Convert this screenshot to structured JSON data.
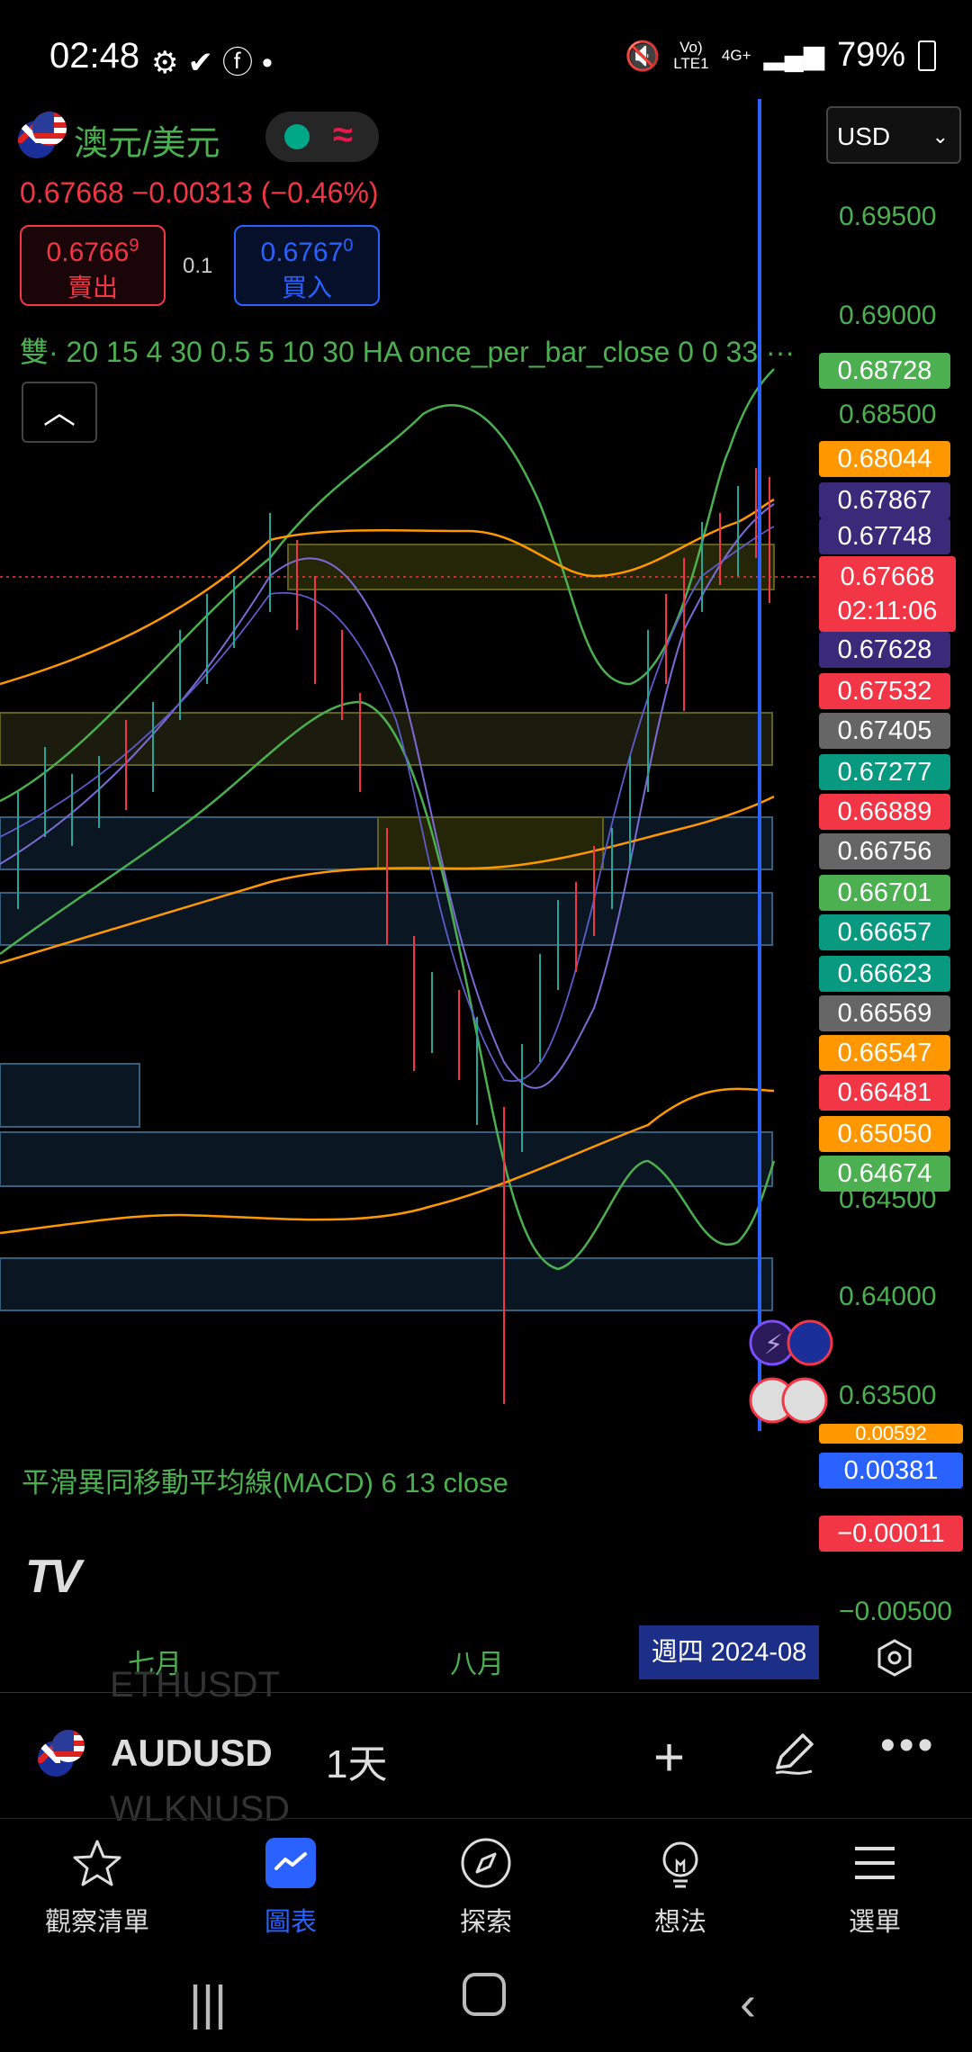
{
  "status_bar": {
    "time": "02:48",
    "network": "Vo) LTE1",
    "network_type": "4G+",
    "battery": "79%"
  },
  "header": {
    "symbol_title": "澳元/美元",
    "price_change": "0.67668 −0.00313 (−0.46%)",
    "sell_price": "0.6766",
    "sell_price_sup": "9",
    "sell_label": "賣出",
    "spread": "0.1",
    "buy_price": "0.6767",
    "buy_price_sup": "0",
    "buy_label": "買入",
    "indicator_settings": "雙· 20 15 4 30 0.5 5 10 30 HA once_per_bar_close 0 0 33 ···",
    "currency": "USD"
  },
  "price_axis": {
    "labels": [
      "0.69500",
      "0.69000",
      "0.68500",
      "0.64500",
      "0.64000",
      "0.63500"
    ]
  },
  "price_tags": [
    {
      "value": "0.68728",
      "color": "#4caf50"
    },
    {
      "value": "0.68044",
      "color": "#ff9800"
    },
    {
      "value": "0.67867",
      "color": "#3a2a7a"
    },
    {
      "value": "0.67748",
      "color": "#3a2a7a"
    },
    {
      "value": "0.67628",
      "color": "#3a2a7a"
    },
    {
      "value": "0.67532",
      "color": "#f23645"
    },
    {
      "value": "0.67405",
      "color": "#666"
    },
    {
      "value": "0.67277",
      "color": "#089981"
    },
    {
      "value": "0.66889",
      "color": "#f23645"
    },
    {
      "value": "0.66756",
      "color": "#666"
    },
    {
      "value": "0.66701",
      "color": "#4caf50"
    },
    {
      "value": "0.66657",
      "color": "#089981"
    },
    {
      "value": "0.66623",
      "color": "#089981"
    },
    {
      "value": "0.66569",
      "color": "#666"
    },
    {
      "value": "0.66547",
      "color": "#ff9800"
    },
    {
      "value": "0.66481",
      "color": "#f23645"
    },
    {
      "value": "0.65050",
      "color": "#ff9800"
    },
    {
      "value": "0.64674",
      "color": "#4caf50"
    }
  ],
  "current_price": {
    "value": "0.67668",
    "countdown": "02:11:06"
  },
  "macd": {
    "label": "平滑異同移動平均線(MACD) 6 13 close",
    "tag_top": "0.00381",
    "tag_value": "−0.00011",
    "axis_label": "−0.00500",
    "partial_label": "0.00592"
  },
  "time_axis": {
    "months": [
      "七月",
      "八月"
    ],
    "cursor_date": "週四 2024-08"
  },
  "toolbar": {
    "symbol": "AUDUSD",
    "interval": "1天",
    "ghost_top": "ETHUSDT",
    "ghost_bottom": "WLKNUSD"
  },
  "bottom_nav": {
    "items": [
      {
        "label": "觀察清單",
        "icon": "star-icon"
      },
      {
        "label": "圖表",
        "icon": "chart-icon"
      },
      {
        "label": "探索",
        "icon": "compass-icon"
      },
      {
        "label": "想法",
        "icon": "lightbulb-icon"
      },
      {
        "label": "選單",
        "icon": "menu-icon"
      }
    ]
  },
  "colors": {
    "up": "#26a69a",
    "down": "#f23645",
    "accent": "#2962ff",
    "green_text": "#4caf50"
  }
}
